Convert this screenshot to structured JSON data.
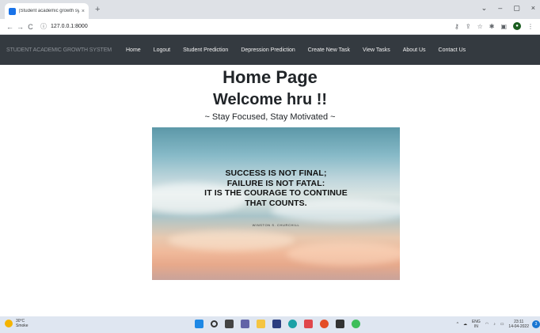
{
  "browser": {
    "tab_title": "|Student academic growth syst",
    "tab_close": "×",
    "new_tab": "+",
    "url": "127.0.0.1:8000",
    "back": "←",
    "forward": "→",
    "reload": "C",
    "window_controls": [
      "⌄",
      "–",
      "▢",
      "×"
    ]
  },
  "navbar": {
    "brand": "STUDENT ACADEMIC GROWTH SYSTEM",
    "links": [
      "Home",
      "Logout",
      "Student Prediction",
      "Depression Prediction",
      "Create New Task",
      "View Tasks",
      "About Us",
      "Contact Us"
    ]
  },
  "main": {
    "page_title": "Home Page",
    "welcome": "Welcome hru !!",
    "tagline": "~ Stay Focused, Stay Motivated ~",
    "quote_lines": [
      "SUCCESS IS NOT FINAL;",
      "FAILURE IS NOT FATAL:",
      "IT IS THE COURAGE TO CONTINUE",
      "THAT COUNTS."
    ],
    "quote_author": "WINSTON S. CHURCHILL"
  },
  "taskbar": {
    "weather_temp": "30°C",
    "weather_desc": "Smoke",
    "lang_top": "ENG",
    "lang_bottom": "IN",
    "time": "23:11",
    "date": "14-04-2022",
    "notification_count": "3"
  },
  "colors": {
    "navbar_bg": "#343a40",
    "taskbar_bg": "#dfe6f1"
  }
}
